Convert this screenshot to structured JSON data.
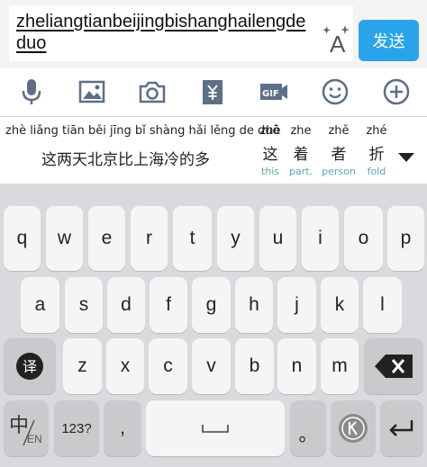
{
  "input": {
    "typed_text": "zheliangtianbeijingbishanghailengdeduo",
    "send_label": "发送"
  },
  "toolbar": {
    "icons": [
      "microphone-icon",
      "image-icon",
      "camera-icon",
      "currency-icon",
      "gif-icon",
      "emoji-icon",
      "plus-icon"
    ],
    "gif_label": "GIF"
  },
  "candidates": {
    "pinyin": "zhè liǎng tiān běi jīng bǐ shàng hǎi lěng de duō",
    "main": "这两天北京比上海冷的多",
    "items": [
      {
        "pinyin": "zhè",
        "hanzi": "这",
        "gloss": "this"
      },
      {
        "pinyin": "zhe",
        "hanzi": "着",
        "gloss": "part."
      },
      {
        "pinyin": "zhě",
        "hanzi": "者",
        "gloss": "person"
      },
      {
        "pinyin": "zhé",
        "hanzi": "折",
        "gloss": "fold"
      }
    ]
  },
  "keyboard": {
    "row1": [
      "q",
      "w",
      "e",
      "r",
      "t",
      "y",
      "u",
      "i",
      "o",
      "p"
    ],
    "row2": [
      "a",
      "s",
      "d",
      "f",
      "g",
      "h",
      "j",
      "k",
      "l"
    ],
    "row3": [
      "z",
      "x",
      "c",
      "v",
      "b",
      "n",
      "m"
    ],
    "translate_label": "译",
    "lang_label_main": "中",
    "lang_label_sub": "EN",
    "numbers_label": "123?",
    "comma_label": ",",
    "period_label": "。"
  },
  "colors": {
    "send_button": "#29a4ea",
    "keyboard_bg": "#d9dadd",
    "gloss": "#5aa8a8"
  }
}
